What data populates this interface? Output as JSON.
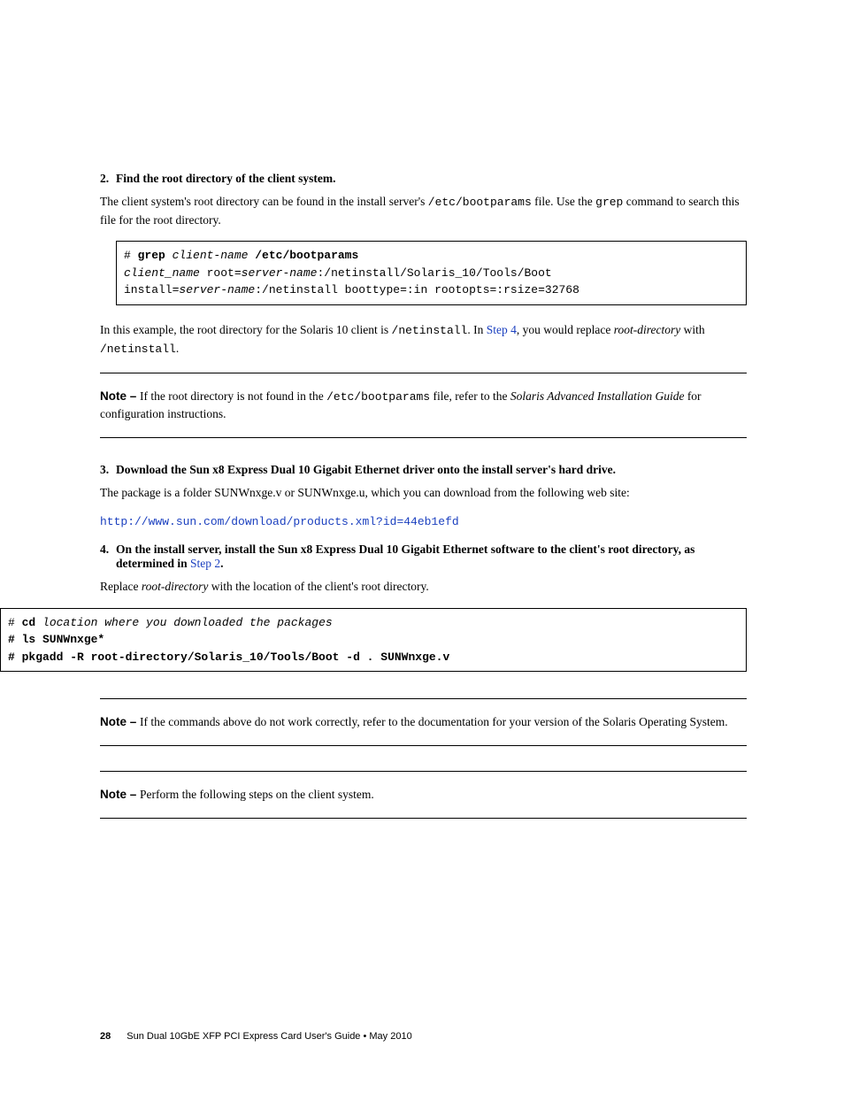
{
  "step2": {
    "num": "2.",
    "title": "Find the root directory of the client system.",
    "para_a": "The client system's root directory can be found in the install server's ",
    "para_mono1": "/etc/bootparams",
    "para_b": " file. Use the ",
    "para_mono2": "grep",
    "para_c": " command to search this file for the root directory."
  },
  "code1": {
    "l1a": "# ",
    "l1b": "grep",
    "l1c": " client-name",
    "l1d": " /etc/bootparams",
    "l2a": "client_name",
    "l2b": " root=",
    "l2c": "server-name",
    "l2d": ":/netinstall/Solaris_10/Tools/Boot",
    "l3a": "install=",
    "l3b": "server-name",
    "l3c": ":/netinstall boottype=:in rootopts=:rsize=32768"
  },
  "example": {
    "a": "In this example, the root directory for the Solaris 10 client is ",
    "mono": "/netinstall",
    "b": ". In ",
    "link": "Step 4",
    "c": ", you would replace ",
    "ital": "root-directory",
    "d": " with ",
    "mono2": "/netinstall",
    "e": "."
  },
  "note1": {
    "label": "Note – ",
    "a": "If the root directory is not found in the ",
    "mono": "/etc/bootparams",
    "b": " file, refer to the ",
    "ital": "Solaris Advanced Installation Guide",
    "c": " for configuration instructions."
  },
  "step3": {
    "num": "3.",
    "title": "Download the Sun x8 Express Dual 10 Gigabit Ethernet driver onto the install server's hard drive.",
    "para": "The package is a folder SUNWnxge.v or SUNWnxge.u, which you can download from the following web site:",
    "url": "http://www.sun.com/download/products.xml?id=44eb1efd"
  },
  "step4": {
    "num": "4.",
    "title_a": "On the install server, install the Sun x8 Express Dual 10 Gigabit Ethernet software to the client's root directory, as determined in ",
    "link": "Step 2",
    "title_b": ".",
    "para_a": "Replace ",
    "ital": "root-directory",
    "para_b": " with the location of the client's root directory."
  },
  "code2": {
    "l1a": "# ",
    "l1b": "cd",
    "l1c": " location where you downloaded the packages",
    "l2": "# ls SUNWnxge*",
    "l3": "# pkgadd -R root-directory/Solaris_10/Tools/Boot -d . SUNWnxge.v"
  },
  "note2": {
    "label": "Note – ",
    "text": "If the commands above do not work correctly, refer to the documentation for your version of the Solaris Operating System."
  },
  "note3": {
    "label": "Note – ",
    "text": "Perform the following steps on the client system."
  },
  "footer": {
    "pagenum": "28",
    "text": "Sun Dual 10GbE XFP PCI Express Card User's Guide  •  May 2010"
  }
}
